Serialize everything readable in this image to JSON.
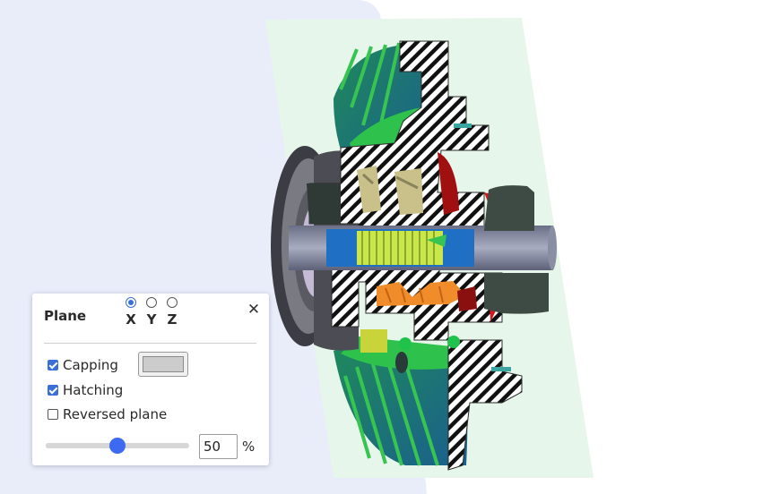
{
  "colors": {
    "background_shape": "#e9edfa",
    "section_plane": "#e6f6ea",
    "accent": "#3b6fd8",
    "capping_color": "#cccccc"
  },
  "panel": {
    "title": "Plane",
    "close_icon": "close-icon",
    "axes": [
      {
        "label": "X",
        "checked": true
      },
      {
        "label": "Y",
        "checked": false
      },
      {
        "label": "Z",
        "checked": false
      }
    ],
    "options": [
      {
        "label": "Capping",
        "checked": true
      },
      {
        "label": "Hatching",
        "checked": true
      },
      {
        "label": "Reversed plane",
        "checked": false
      }
    ],
    "slider": {
      "value": 50,
      "min": 0,
      "max": 100
    },
    "input_value": "50",
    "unit": "%"
  }
}
